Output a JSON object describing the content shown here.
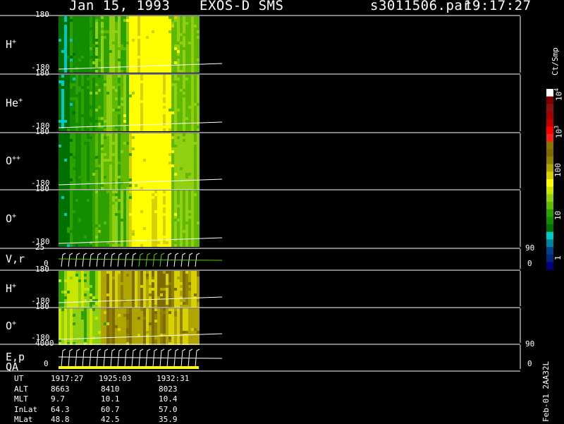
{
  "header": {
    "date": "Jan 15, 1993",
    "instrument": "EXOS-D SMS",
    "file": "s3011506.par",
    "time": "19:17:27"
  },
  "panels": [
    {
      "label": "H",
      "sup": "+",
      "ymax": "180",
      "ymin": "-180"
    },
    {
      "label": "He",
      "sup": "+",
      "ymax": "180",
      "ymin": "-180"
    },
    {
      "label": "O",
      "sup": "++",
      "ymax": "180",
      "ymin": "-180"
    },
    {
      "label": "O",
      "sup": "+",
      "ymax": "180",
      "ymin": "-180"
    },
    {
      "label": "V,r",
      "sup": "",
      "ymax": "25",
      "ymin": "0",
      "rmax": "90",
      "rmin": "0"
    },
    {
      "label": "H",
      "sup": "+",
      "ymax": "180",
      "ymin": "-180"
    },
    {
      "label": "O",
      "sup": "+",
      "ymax": "180",
      "ymin": "-180"
    },
    {
      "label": "E,p",
      "sup": "",
      "label2": "QA",
      "ymax": "4000",
      "ymin": "0",
      "rmax": "90",
      "rmin": "0"
    }
  ],
  "colorbar": {
    "unit": "Ct/Smp",
    "labels": [
      {
        "base": "10",
        "exp": "4"
      },
      {
        "base": "10",
        "exp": "3"
      },
      {
        "base": "100",
        "exp": ""
      },
      {
        "base": "10",
        "exp": ""
      },
      {
        "base": "1",
        "exp": ""
      }
    ],
    "colors": [
      "#ffffff",
      "#800000",
      "#8b1010",
      "#a00000",
      "#c00000",
      "#ff0000",
      "#ff2020",
      "#8b7500",
      "#7d6a00",
      "#8f8200",
      "#b0a500",
      "#d8d000",
      "#ffff00",
      "#c8e600",
      "#90d010",
      "#60b800",
      "#2ea000",
      "#148c00",
      "#007000",
      "#00c8c8",
      "#0080a0",
      "#00408c",
      "#002878",
      "#000080"
    ]
  },
  "chart_data": {
    "type": "heatmap",
    "ut": [
      "1917:27",
      "1925:03",
      "1932:31"
    ],
    "rows": [
      {
        "name": "UT",
        "values": [
          "1917:27",
          "1925:03",
          "1932:31"
        ]
      },
      {
        "name": "ALT",
        "values": [
          "8663",
          "8410",
          "8023"
        ]
      },
      {
        "name": "MLT",
        "values": [
          "9.7",
          "10.1",
          "10.4"
        ]
      },
      {
        "name": "InLat",
        "values": [
          "64.3",
          "60.7",
          "57.0"
        ]
      },
      {
        "name": "MLat",
        "values": [
          "48.8",
          "42.5",
          "35.9"
        ]
      }
    ]
  },
  "footer": {
    "stamp": "Feb-01 2AA32L"
  }
}
